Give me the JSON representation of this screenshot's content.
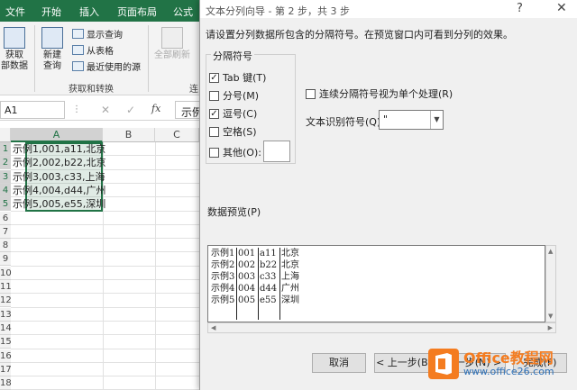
{
  "excel": {
    "tabs": [
      "文件",
      "开始",
      "插入",
      "页面布局",
      "公式"
    ],
    "ribbon": {
      "get_data_line1": "获取",
      "get_data_line2": "部数据",
      "new_query_line1": "新建",
      "new_query_line2": "查询",
      "show_query": "显示查询",
      "from_table": "从表格",
      "recent_sources": "最近使用的源",
      "group_label": "获取和转换",
      "refresh_all": "全部刷新",
      "partial_group": "连"
    },
    "name_box": "A1",
    "fx_label": "fx",
    "formula_value": "示例",
    "columns": [
      "A",
      "B",
      "C"
    ],
    "rows": [
      "1",
      "2",
      "3",
      "4",
      "5",
      "6",
      "7",
      "8",
      "9",
      "10",
      "11",
      "12",
      "13",
      "14",
      "15",
      "16",
      "17",
      "18"
    ],
    "cells": [
      "示例1,001,a11,北京",
      "示例2,002,b22,北京",
      "示例3,003,c33,上海",
      "示例4,004,d44,广州",
      "示例5,005,e55,深圳"
    ]
  },
  "dialog": {
    "title": "文本分列向导 - 第 2 步，共 3 步",
    "help": "?",
    "close": "✕",
    "instruction": "请设置分列数据所包含的分隔符号。在预览窗口内可看到分列的效果。",
    "delimiters_legend": "分隔符号",
    "delimiters": [
      {
        "label": "Tab 键(T)",
        "checked": true
      },
      {
        "label": "分号(M)",
        "checked": false
      },
      {
        "label": "逗号(C)",
        "checked": true
      },
      {
        "label": "空格(S)",
        "checked": false
      },
      {
        "label": "其他(O):",
        "checked": false
      }
    ],
    "consecutive_label": "连续分隔符号视为单个处理(R)",
    "consecutive_checked": false,
    "qualifier_label": "文本识别符号(Q):",
    "qualifier_value": "\"",
    "preview_label": "数据预览(P)",
    "preview_columns": [
      [
        "示例1",
        "示例2",
        "示例3",
        "示例4",
        "示例5"
      ],
      [
        "001",
        "002",
        "003",
        "004",
        "005"
      ],
      [
        "a11",
        "b22",
        "c33",
        "d44",
        "e55"
      ],
      [
        "北京",
        "北京",
        "上海",
        "广州",
        "深圳"
      ]
    ],
    "buttons": {
      "cancel": "取消",
      "back": "< 上一步(B)",
      "next": "下一步(N) >",
      "finish": "完成(F)"
    }
  },
  "watermark": {
    "line1": "Office教程网",
    "line2": "www.office26.com"
  },
  "colors": {
    "excel_green": "#217346",
    "watermark_orange": "#f47c20",
    "watermark_blue": "#2c6fb7"
  }
}
